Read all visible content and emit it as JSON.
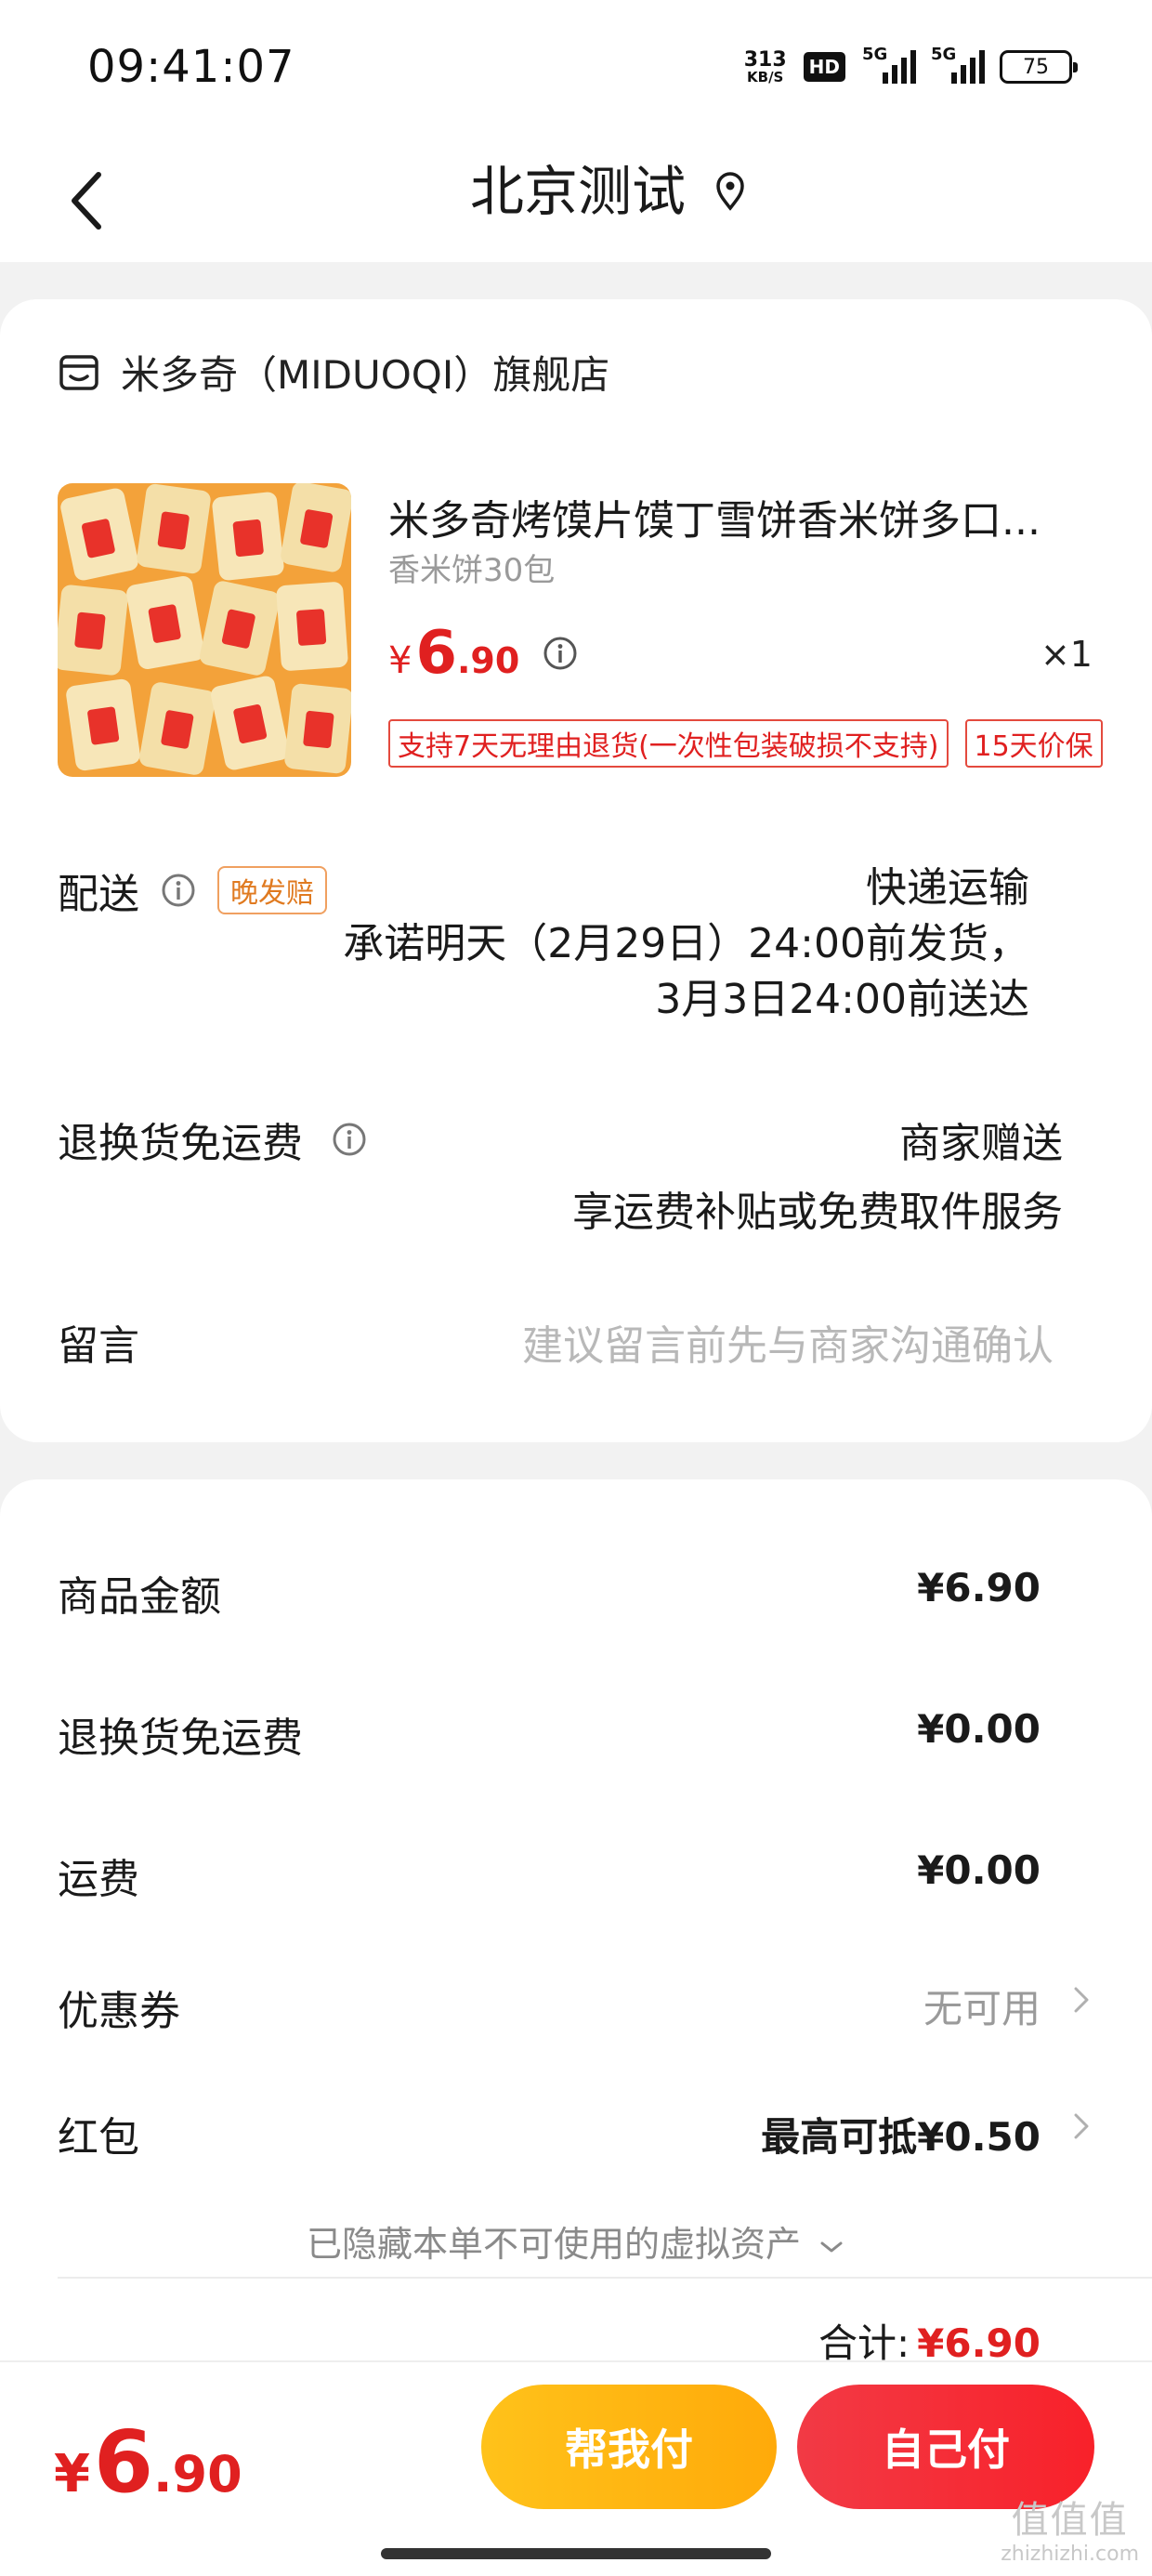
{
  "status_bar": {
    "time": "09:41:07",
    "net_speed_value": "313",
    "net_speed_unit": "KB/S",
    "hd_label": "HD",
    "sim1_label": "5G",
    "sim2_label": "5G",
    "battery": "75"
  },
  "nav": {
    "title": "北京测试"
  },
  "shop": {
    "name": "米多奇（MIDUOQI）旗舰店"
  },
  "product": {
    "title": "米多奇烤馍片馍丁雪饼香米饼多口...",
    "spec": "香米饼30包",
    "price_symbol": "¥",
    "price_int": "6",
    "price_dec": ".90",
    "quantity": "×1",
    "tags": [
      "支持7天无理由退货(一次性包装破损不支持)",
      "15天价保"
    ]
  },
  "delivery": {
    "label": "配送",
    "badge": "晚发赔",
    "method": "快递运输",
    "promise_line1": "承诺明天（2月29日）24:00前发货，",
    "promise_line2": "3月3日24:00前送达"
  },
  "return_shipping": {
    "label": "退换货免运费",
    "value": "商家赠送",
    "desc": "享运费补贴或免费取件服务"
  },
  "message": {
    "label": "留言",
    "placeholder": "建议留言前先与商家沟通确认"
  },
  "summary": {
    "goods_amount_label": "商品金额",
    "goods_amount": "¥6.90",
    "return_fee_label": "退换货免运费",
    "return_fee": "¥0.00",
    "shipping_label": "运费",
    "shipping": "¥0.00",
    "coupon_label": "优惠券",
    "coupon_value": "无可用",
    "redpacket_label": "红包",
    "redpacket_value": "最高可抵¥0.50",
    "hidden_assets": "已隐藏本单不可使用的虚拟资产",
    "total_label": "合计:",
    "total_value": "¥6.90"
  },
  "bottom": {
    "price_symbol": "¥",
    "price_int": "6",
    "price_dec": ".90",
    "help_pay": "帮我付",
    "self_pay": "自己付",
    "watermark_glyphs": "值值值",
    "watermark_url": "zhizhizhi.com"
  },
  "colors": {
    "accent_red": "#e02020",
    "help_button": "#ffb80f",
    "self_button": "#f5303a",
    "late_badge": "#e07a20"
  }
}
